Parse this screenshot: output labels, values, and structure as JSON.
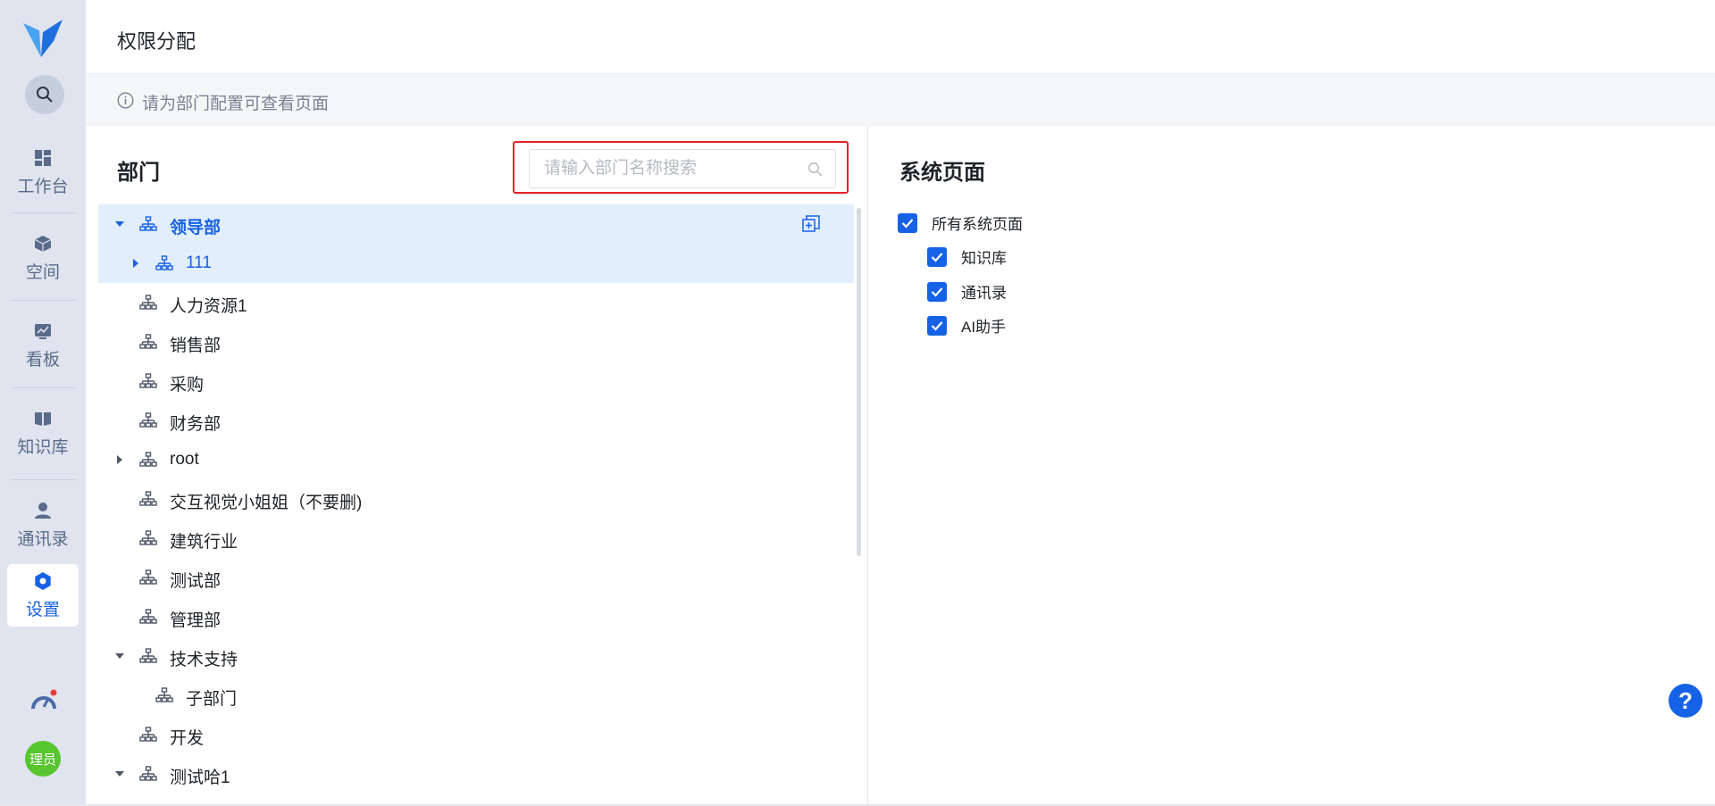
{
  "sidebar": {
    "nav": [
      {
        "label": "工作台",
        "icon": "dashboard-icon"
      },
      {
        "label": "空间",
        "icon": "cube-icon"
      },
      {
        "label": "看板",
        "icon": "chart-board-icon"
      },
      {
        "label": "知识库",
        "icon": "book-icon"
      },
      {
        "label": "通讯录",
        "icon": "contacts-icon"
      },
      {
        "label": "设置",
        "icon": "gear-icon"
      }
    ],
    "active": "设置",
    "avatar_text": "理员"
  },
  "header": {
    "title": "权限分配"
  },
  "notice": {
    "text": "请为部门配置可查看页面"
  },
  "departments": {
    "title": "部门",
    "search_placeholder": "请输入部门名称搜索",
    "tree": [
      {
        "label": "领导部",
        "expanded": true,
        "selected": true
      },
      {
        "label": "111",
        "collapsed": true
      },
      {
        "label": "人力资源1"
      },
      {
        "label": "销售部"
      },
      {
        "label": "采购"
      },
      {
        "label": "财务部"
      },
      {
        "label": "root",
        "collapsed": true
      },
      {
        "label": "交互视觉小姐姐（不要删)"
      },
      {
        "label": "建筑行业"
      },
      {
        "label": "测试部"
      },
      {
        "label": "管理部"
      },
      {
        "label": "技术支持",
        "expanded": true
      },
      {
        "label": "子部门"
      },
      {
        "label": "开发"
      },
      {
        "label": "测试哈1",
        "expanded": true
      }
    ]
  },
  "system_pages": {
    "title": "系统页面",
    "all_label": "所有系统页面",
    "items": [
      "知识库",
      "通讯录",
      "AI助手"
    ]
  },
  "colors": {
    "accent": "#1662e6",
    "highlight_border": "#e8202a",
    "sidebar_bg": "#dfe4ef",
    "selected_row": "#e3eefc",
    "avatar": "#57c52e"
  }
}
